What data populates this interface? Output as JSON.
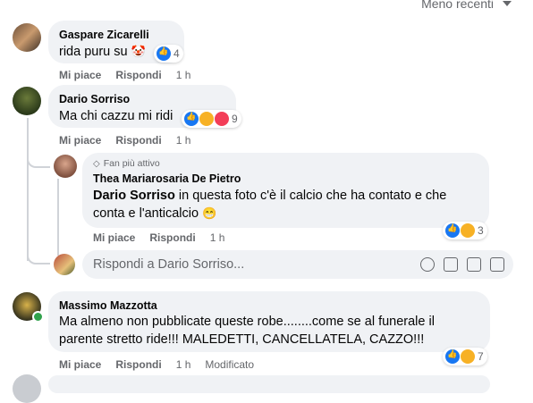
{
  "sort": {
    "label": "Meno recenti"
  },
  "comments": [
    {
      "author": "Gaspare Zicarelli",
      "text": "rida puru su",
      "emoji": "🤡",
      "reaction_count": "4",
      "like_label": "Mi piace",
      "reply_label": "Rispondi",
      "time": "1 h",
      "reactions": [
        "like"
      ]
    },
    {
      "author": "Dario Sorriso",
      "text": "Ma chi cazzu mi ridi",
      "reaction_count": "9",
      "like_label": "Mi piace",
      "reply_label": "Rispondi",
      "time": "1 h",
      "reactions": [
        "like",
        "haha",
        "love"
      ],
      "replies": [
        {
          "badge": "Fan più attivo",
          "author": "Thea Mariarosaria De Pietro",
          "mention": "Dario Sorriso",
          "text_line1": " in questa foto c'è il calcio che ha contato e che",
          "text_line2": "conta e l'anticalcio",
          "emoji": "😁",
          "reaction_count": "3",
          "like_label": "Mi piace",
          "reply_label": "Rispondi",
          "time": "1 h",
          "reactions": [
            "like",
            "sad"
          ]
        }
      ],
      "reply_box": {
        "placeholder": "Rispondi a Dario Sorriso..."
      }
    },
    {
      "author": "Massimo Mazzotta",
      "text_line1": "Ma almeno non pubblicate queste robe........come se al funerale il",
      "text_line2": "parente stretto ride!!! MALEDETTI, CANCELLATELA, CAZZO!!!",
      "reaction_count": "7",
      "like_label": "Mi piace",
      "reply_label": "Rispondi",
      "time": "1 h",
      "edited_label": "Modificato",
      "reactions": [
        "like",
        "sad"
      ]
    }
  ],
  "colors": {
    "bubble": "#f0f2f5",
    "like": "#1877f2",
    "secondary_text": "#65676b",
    "online": "#31a24c"
  }
}
